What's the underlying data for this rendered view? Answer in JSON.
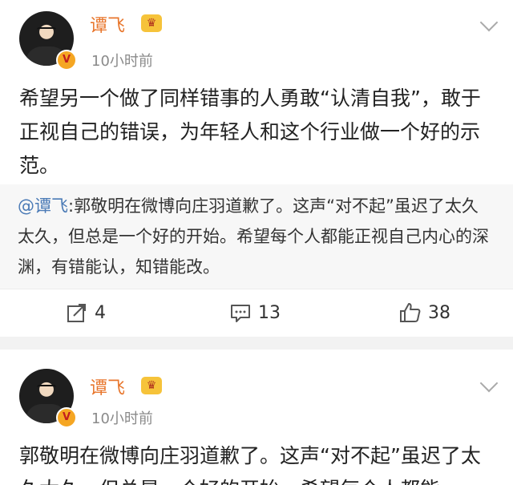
{
  "posts": [
    {
      "author": "谭飞",
      "time": "10小时前",
      "verified_badge": "V",
      "text": "希望另一个做了同样错事的人勇敢“认清自我”，敢于正视自己的错误，为年轻人和这个行业做一个好的示范。",
      "repost": {
        "mention": "@谭飞",
        "text": ":郭敬明在微博向庄羽道歉了。这声“对不起”虽迟了太久太久，但总是一个好的开始。希望每个人都能正视自己内心的深渊，有错能认，知错能改。"
      },
      "actions": {
        "repost_count": "4",
        "comment_count": "13",
        "like_count": "38"
      }
    },
    {
      "author": "谭飞",
      "time": "10小时前",
      "verified_badge": "V",
      "text": "郭敬明在微博向庄羽道歉了。这声“对不起”虽迟了太久太久，但总是一个好的开始。希望每个人都能"
    }
  ],
  "icons": {
    "crown": "crown-icon",
    "chevron": "chevron-down-icon",
    "repost": "repost-icon",
    "comment": "comment-icon",
    "like": "thumbs-up-icon"
  },
  "colors": {
    "author": "#e8762c",
    "mention": "#4a7ab6",
    "badge": "#f5a623"
  }
}
